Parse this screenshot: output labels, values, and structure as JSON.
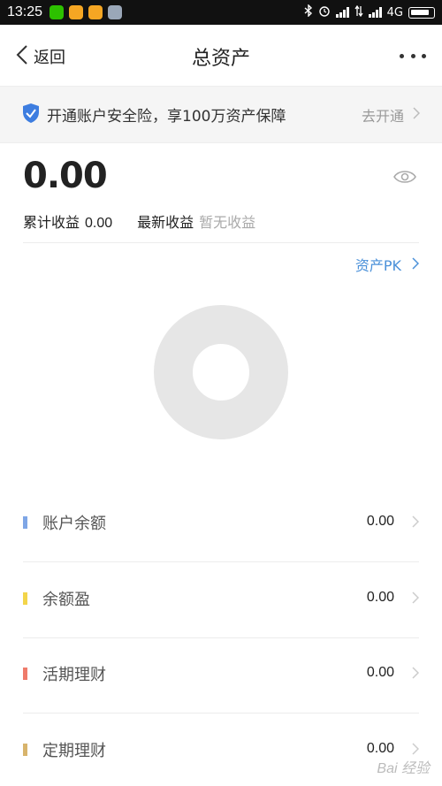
{
  "status_bar": {
    "time": "13:25",
    "network": "4G"
  },
  "nav": {
    "back_label": "返回",
    "title": "总资产"
  },
  "banner": {
    "text": "开通账户安全险，享100万资产保障",
    "action": "去开通"
  },
  "summary": {
    "total": "0.00",
    "cumulative_label": "累计收益",
    "cumulative_value": "0.00",
    "latest_label": "最新收益",
    "latest_value": "暂无收益"
  },
  "pk_link": "资产PK",
  "assets": [
    {
      "label": "账户余额",
      "value": "0.00",
      "color": "#7ea6e6"
    },
    {
      "label": "余额盈",
      "value": "0.00",
      "color": "#f3d54a"
    },
    {
      "label": "活期理财",
      "value": "0.00",
      "color": "#ef7b6b"
    },
    {
      "label": "定期理财",
      "value": "0.00",
      "color": "#d8b46c"
    }
  ],
  "colors": {
    "accent": "#4a90d9",
    "shield": "#3d7de0",
    "donut": "#e6e6e6"
  },
  "watermark": "Bai 经验"
}
